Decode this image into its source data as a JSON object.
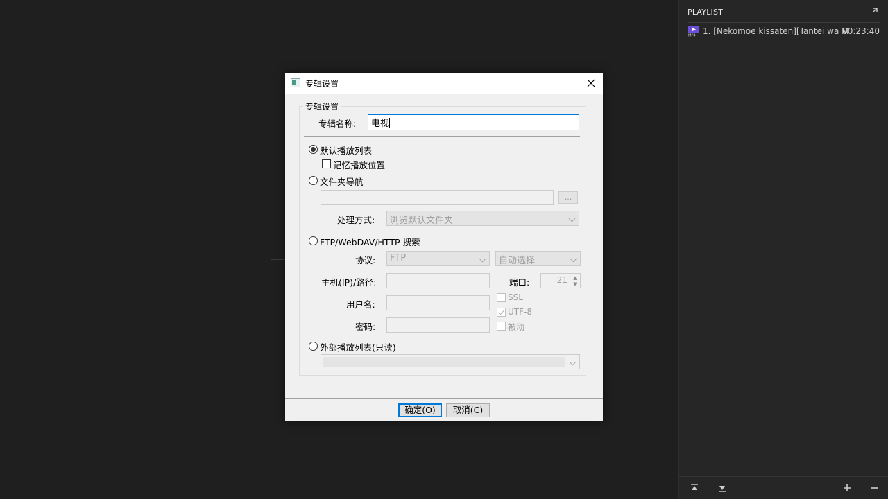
{
  "playlist": {
    "header": "PLAYLIST",
    "items": [
      {
        "name": "1. [Nekomoe kissaten][Tantei wa Mou...",
        "duration": "00:23:40",
        "icon": "mp4-file-icon"
      }
    ],
    "toolbar": [
      "move-top-icon",
      "move-bottom-icon",
      "add-icon",
      "remove-icon"
    ]
  },
  "dialog": {
    "title": "专辑设置",
    "group_title": "专辑设置",
    "name_label": "专辑名称:",
    "name_value": "电视",
    "radio_default": "默认播放列表",
    "check_remember": "记忆播放位置",
    "radio_folder": "文件夹导航",
    "browse_label": "...",
    "process_label": "处理方式:",
    "process_value": "浏览默认文件夹",
    "radio_ftp": "FTP/WebDAV/HTTP 搜索",
    "protocol_label": "协议:",
    "protocol_value": "FTP",
    "auto_select": "自动选择",
    "host_label": "主机(IP)/路径:",
    "port_label": "端口:",
    "port_value": "21",
    "user_label": "用户名:",
    "ssl_label": "SSL",
    "password_label": "密码:",
    "utf8_label": "UTF-8",
    "passive_label": "被动",
    "radio_external": "外部播放列表(只读)",
    "ok_button": "确定(O)",
    "cancel_button": "取消(C)"
  },
  "colors": {
    "accent": "#0078d7",
    "player_bg": "#1f1f1f",
    "playlist_bg": "#262626"
  }
}
